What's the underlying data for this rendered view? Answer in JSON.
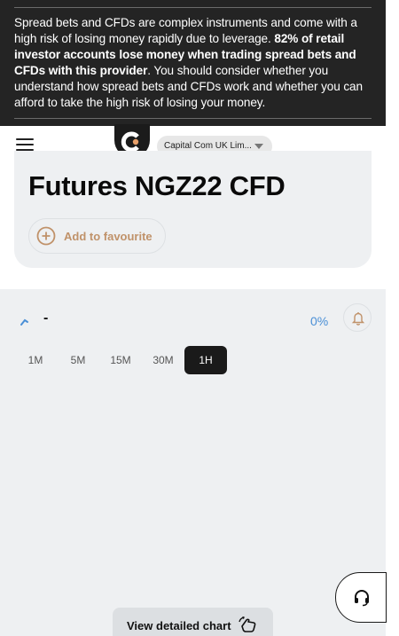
{
  "warning": {
    "text_part1": "Spread bets and CFDs are complex instruments and come with a high risk of losing money rapidly due to leverage. ",
    "text_bold": "82% of retail investor accounts lose money when trading spread bets and CFDs with this provider",
    "text_part2": ". You should consider whether you understand how spread bets and CFDs work and whether you can afford to take the high risk of losing your money."
  },
  "header": {
    "menu_icon": "hamburger-icon",
    "logo_icon": "capital-com-logo",
    "entity_selector": "Capital Com UK Lim..."
  },
  "instrument": {
    "title": "Futures NGZ22 CFD",
    "favourite_label": "Add to favourite",
    "favourite_icon": "plus-circle-icon"
  },
  "chart": {
    "trend_icon": "trend-up-icon",
    "price": "-",
    "change": "0%",
    "alert_icon": "bell-icon",
    "timeframes": [
      {
        "label": "1M",
        "active": false
      },
      {
        "label": "5M",
        "active": false
      },
      {
        "label": "15M",
        "active": false
      },
      {
        "label": "30M",
        "active": false
      },
      {
        "label": "1H",
        "active": true
      }
    ],
    "view_button_label": "View detailed chart",
    "view_button_icon": "hand-swipe-icon"
  },
  "support": {
    "icon": "headset-icon"
  },
  "colors": {
    "warning_bg": "#242424",
    "card_bg": "#eef0f2",
    "favourite_accent": "#c0926a",
    "change_color": "#4a8fd6",
    "active_timeframe_bg": "#1a1a1a"
  }
}
